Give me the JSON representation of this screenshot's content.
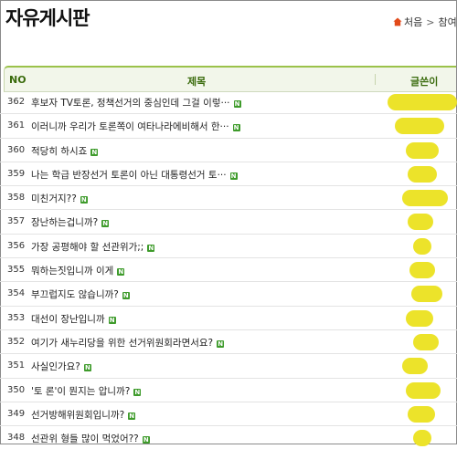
{
  "board": {
    "title": "자유게시판",
    "breadcrumb": {
      "home": "처음",
      "separator": ">",
      "current": "참여마"
    }
  },
  "table": {
    "headers": {
      "no": "NO",
      "subject": "제목",
      "author": "글쓴이"
    },
    "new_badge": "N",
    "rows": [
      {
        "no": "362",
        "title": "후보자 TV토론, 정책선거의 중심인데 그걸 이렇···"
      },
      {
        "no": "361",
        "title": "이러니까 우리가 토론쪽이 여타나라에비해서 한···"
      },
      {
        "no": "360",
        "title": "적당히 하시죠"
      },
      {
        "no": "359",
        "title": "나는 학급 반장선거 토론이 아닌 대통령선거 토···"
      },
      {
        "no": "358",
        "title": "미친거지??"
      },
      {
        "no": "357",
        "title": "장난하는겁니까?"
      },
      {
        "no": "356",
        "title": "가장 공평해야 할 선관위가;;"
      },
      {
        "no": "355",
        "title": "뭐하는짓입니까 이게"
      },
      {
        "no": "354",
        "title": "부끄럽지도 않습니까?"
      },
      {
        "no": "353",
        "title": "대선이 장난입니까"
      },
      {
        "no": "352",
        "title": "여기가 새누리당을 위한 선거위원회라면서요?"
      },
      {
        "no": "351",
        "title": "사실인가요?"
      },
      {
        "no": "350",
        "title": "'토 론'이 뭔지는 압니까?"
      },
      {
        "no": "349",
        "title": "선거방해위원회입니까?"
      },
      {
        "no": "348",
        "title": "선관위 형들 많이 먹었어??"
      }
    ]
  },
  "colors": {
    "accent": "#9bc24a",
    "header_text": "#3a6b0c",
    "new_badge": "#3e9b2b",
    "author_mask": "#ece32a"
  }
}
